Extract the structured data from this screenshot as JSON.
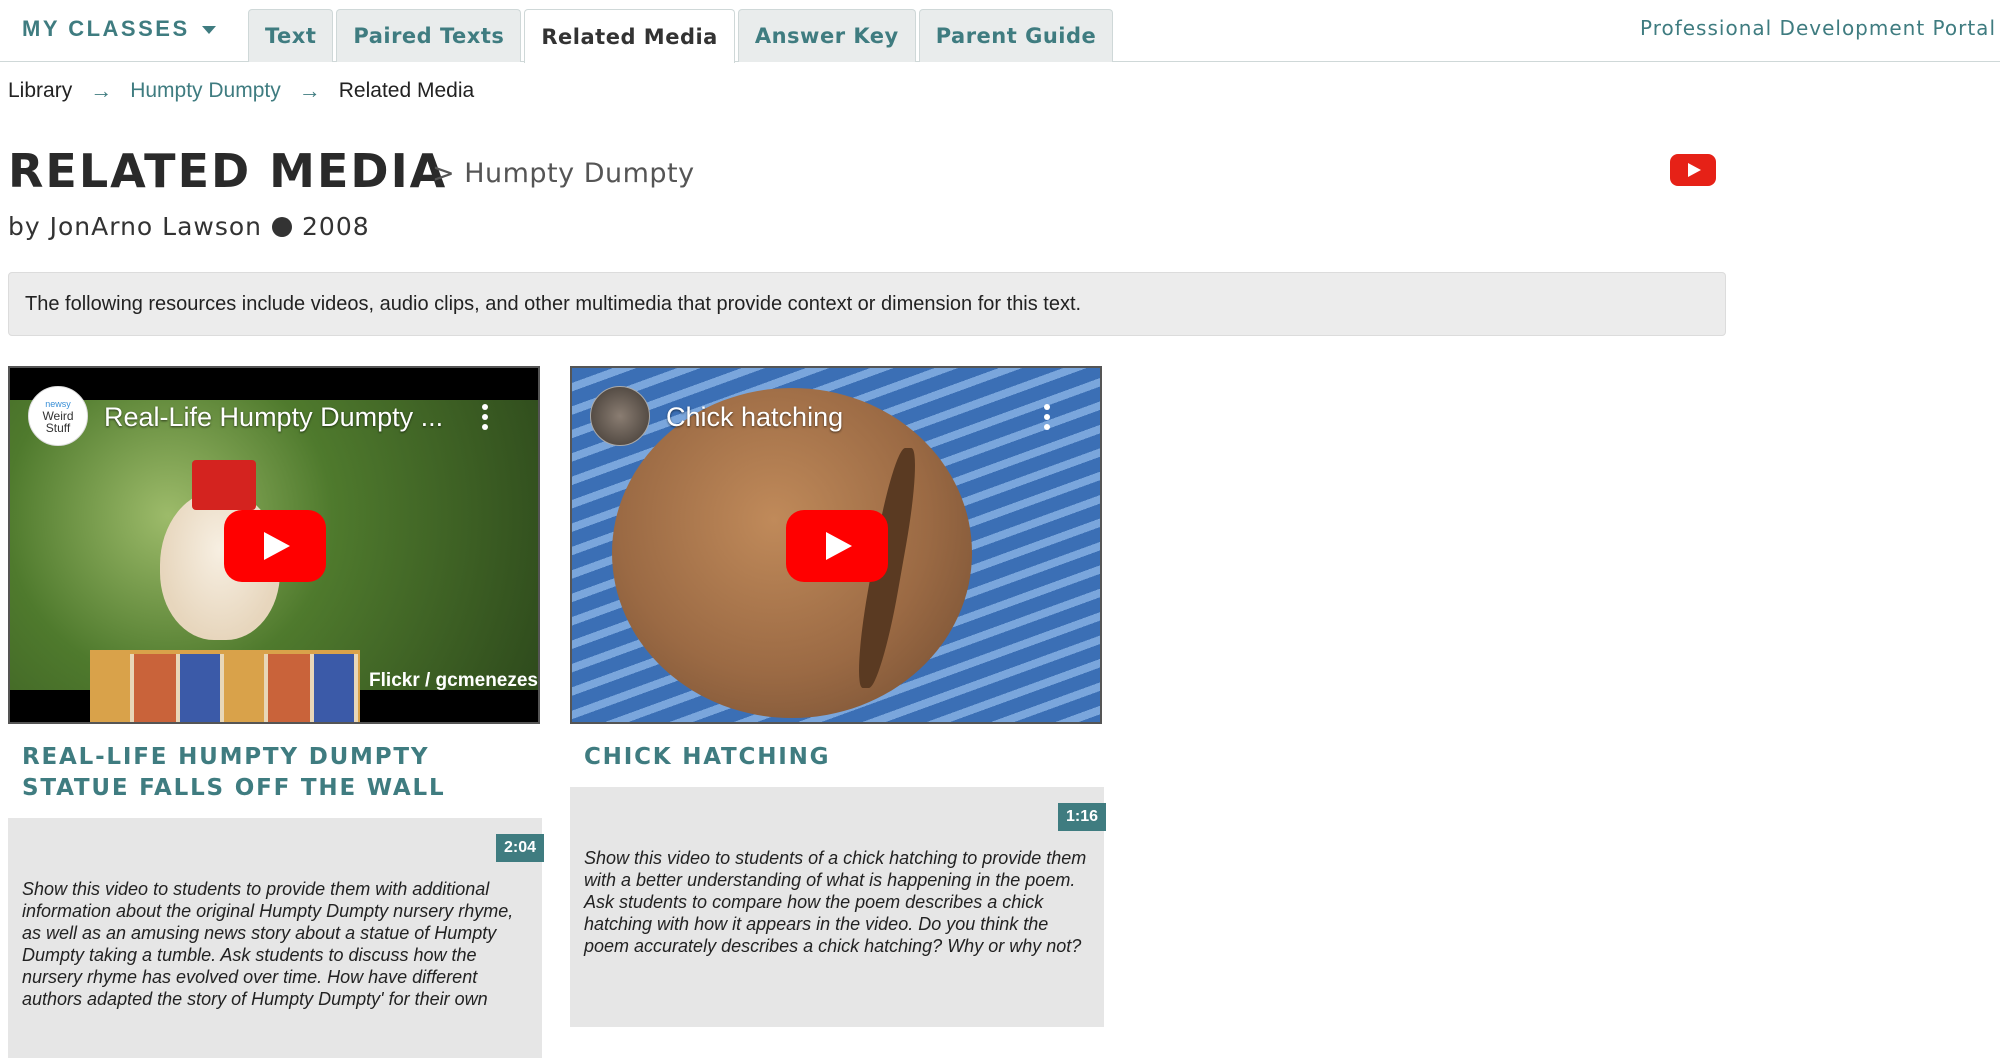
{
  "nav": {
    "my_classes": "MY CLASSES",
    "tabs": [
      {
        "label": "Text"
      },
      {
        "label": "Paired Texts"
      },
      {
        "label": "Related Media",
        "active": true
      },
      {
        "label": "Answer Key"
      },
      {
        "label": "Parent Guide"
      }
    ],
    "portal_link": "Professional Development Portal"
  },
  "breadcrumb": {
    "library": "Library",
    "text": "Humpty Dumpty",
    "current": "Related Media"
  },
  "header": {
    "title": "RELATED MEDIA",
    "subtitle": "> Humpty Dumpty",
    "author": "by JonArno Lawson",
    "year": "2008",
    "youtube_icon": "youtube-icon"
  },
  "info": "The following resources include videos, audio clips, and other multimedia that provide context or dimension for this text.",
  "colors": {
    "accent": "#3f7c80",
    "youtube_red": "#ff0000"
  },
  "media": [
    {
      "video_title": "Real-Life Humpty Dumpty ...",
      "channel_avatar_text": [
        "newsy",
        "Weird",
        "Stuff"
      ],
      "credit": "Flickr / gcmenezes",
      "title": "Real-Life Humpty Dumpty Statue Falls Off the Wall",
      "duration": "2:04",
      "description": "Show this video to students to provide them with additional information about the original Humpty Dumpty nursery rhyme, as well as an amusing news story about a statue of Humpty Dumpty taking a tumble. Ask students to discuss how the nursery rhyme has evolved over time. How have different authors adapted the story of Humpty Dumpty' for their own"
    },
    {
      "video_title": "Chick hatching",
      "title": "Chick Hatching",
      "duration": "1:16",
      "description": "Show this video to students of a chick hatching to provide them with a better understanding of what is happening in the poem. Ask students to compare how the poem describes a chick hatching with how it appears in the video. Do you think the poem accurately describes a chick hatching? Why or why not?"
    }
  ]
}
